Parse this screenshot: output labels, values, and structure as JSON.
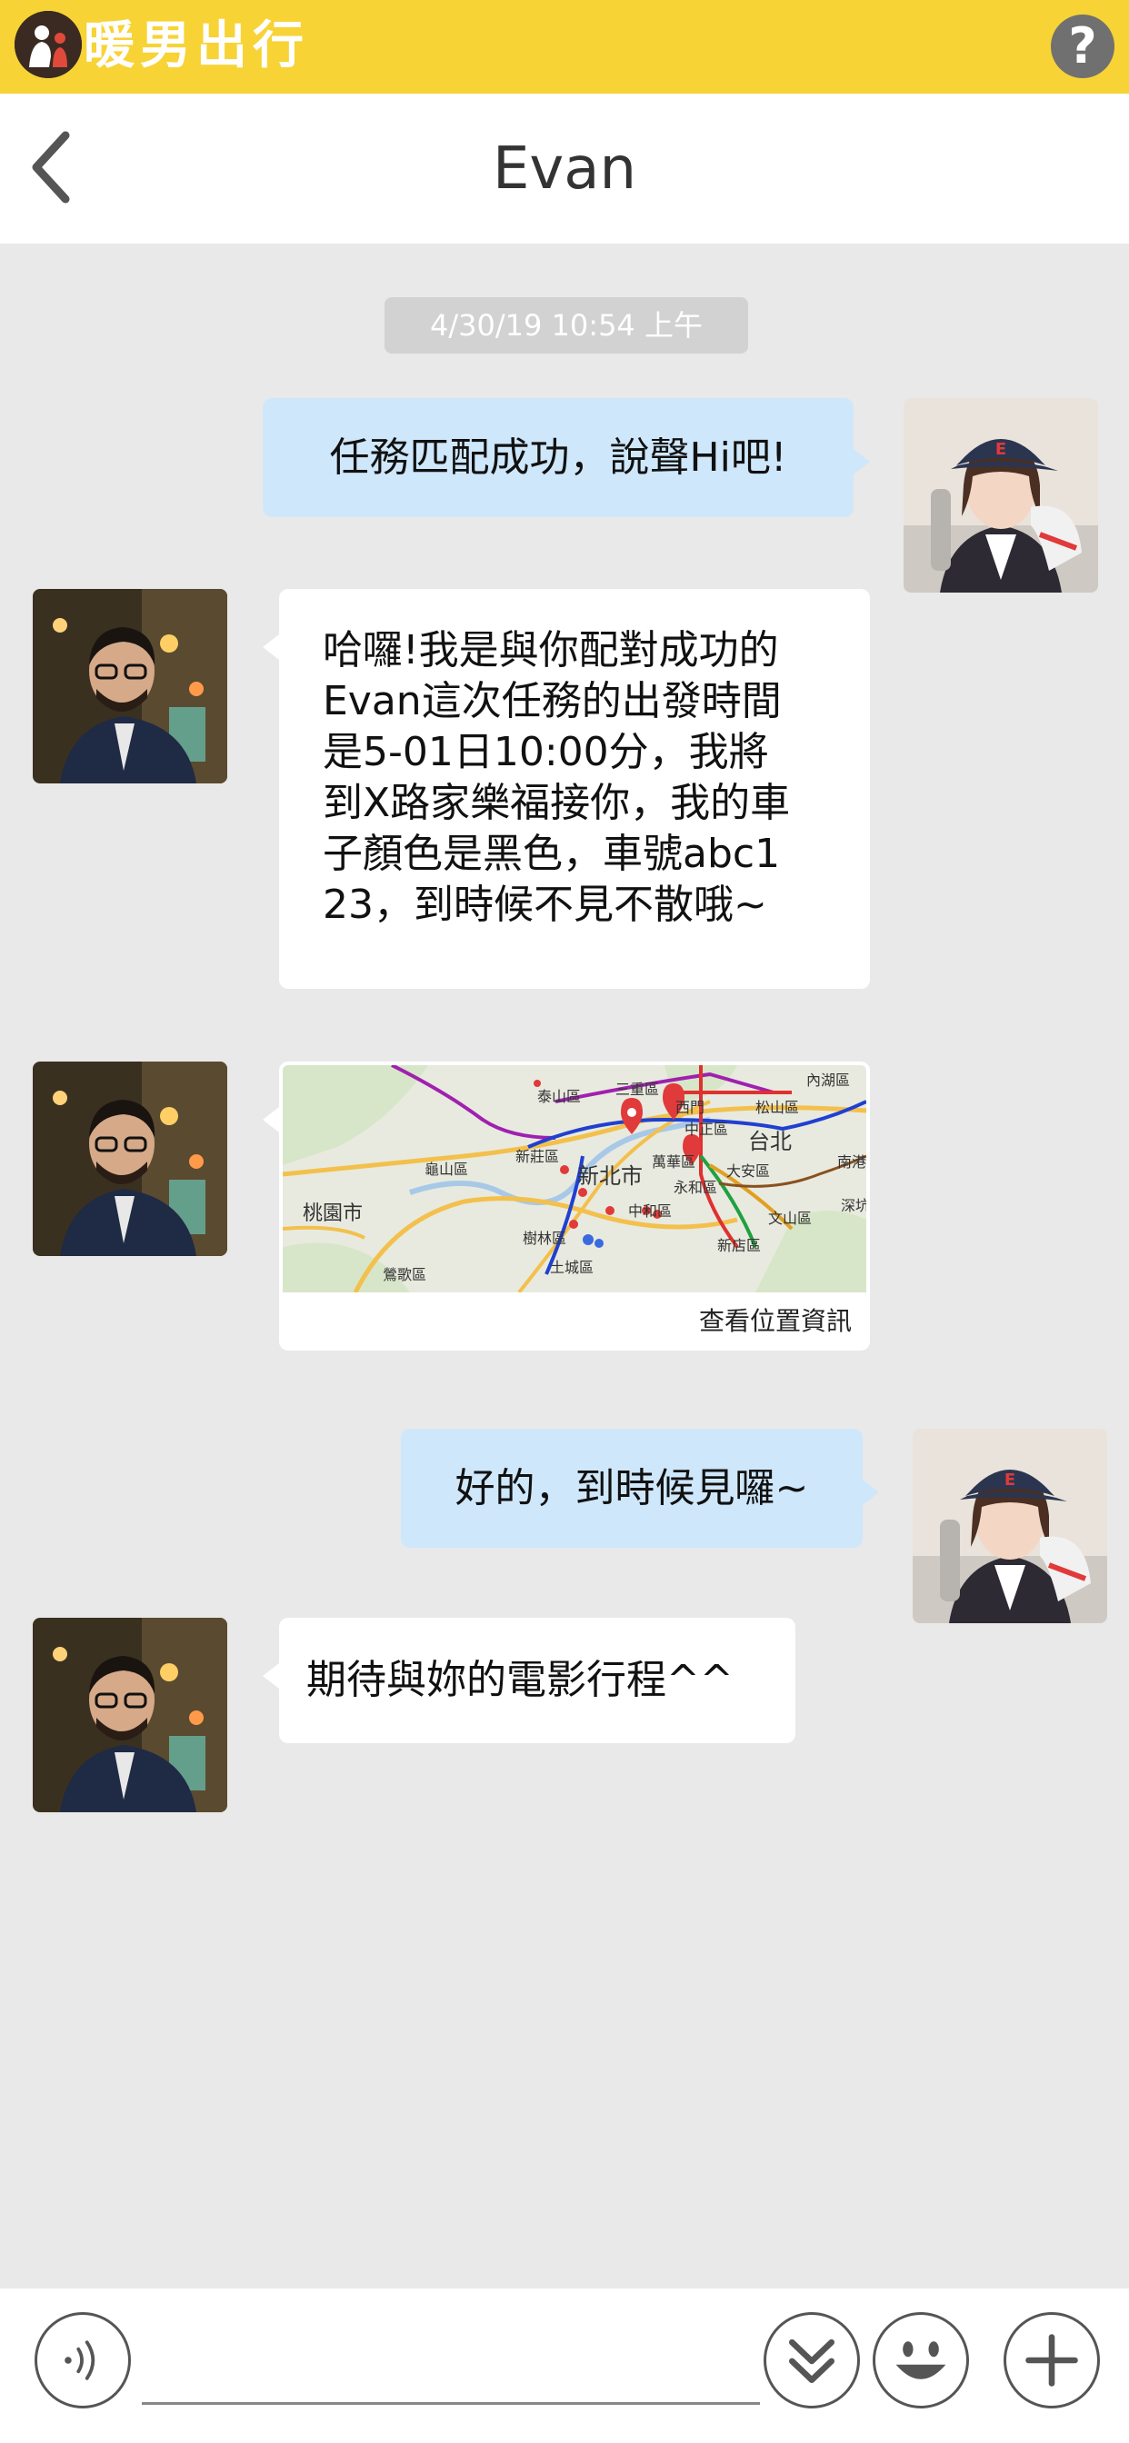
{
  "app": {
    "brand": "暖男出行",
    "help_icon": "question-circle-icon",
    "help_label": "?",
    "brand_color": "#f7d335"
  },
  "header": {
    "title": "Evan",
    "back_icon": "chevron-left-icon"
  },
  "conversation": {
    "timestamp": "4/30/19 10:54 上午",
    "messages": [
      {
        "side": "sent",
        "text": "任務匹配成功，說聲Hi吧!"
      },
      {
        "side": "received",
        "lines": [
          "哈囉!我是與你配對成功的",
          "Evan這次任務的出發時間",
          "是5-01日10:00分，我將",
          "到X路家樂福接你，我的車",
          "子顏色是黑色，車號abc1",
          "23，到時候不見不散哦~"
        ]
      },
      {
        "side": "received",
        "type": "map",
        "link_label": "查看位置資訊",
        "map_labels": [
          "泰山區",
          "三重區",
          "西門",
          "內湖區",
          "松山區",
          "新莊區",
          "中正區",
          "萬華區",
          "台北",
          "南港",
          "龜山區",
          "新北市",
          "大安區",
          "桃園市",
          "永和區",
          "深坑",
          "中和區",
          "文山區",
          "樹林區",
          "新店區",
          "土城區",
          "鶯歌區"
        ]
      },
      {
        "side": "sent",
        "text": "好的，到時候見囉~"
      },
      {
        "side": "received",
        "text": "期待與妳的電影行程^^"
      }
    ]
  },
  "input_bar": {
    "placeholder": "",
    "voice_icon": "voice-icon",
    "scroll_icon": "double-chevron-down-icon",
    "emoji_icon": "smiley-icon",
    "plus_icon": "plus-icon"
  },
  "colors": {
    "sent_bubble": "#cfe7fb",
    "received_bubble": "#ffffff",
    "chat_background": "#e9e9e9"
  }
}
